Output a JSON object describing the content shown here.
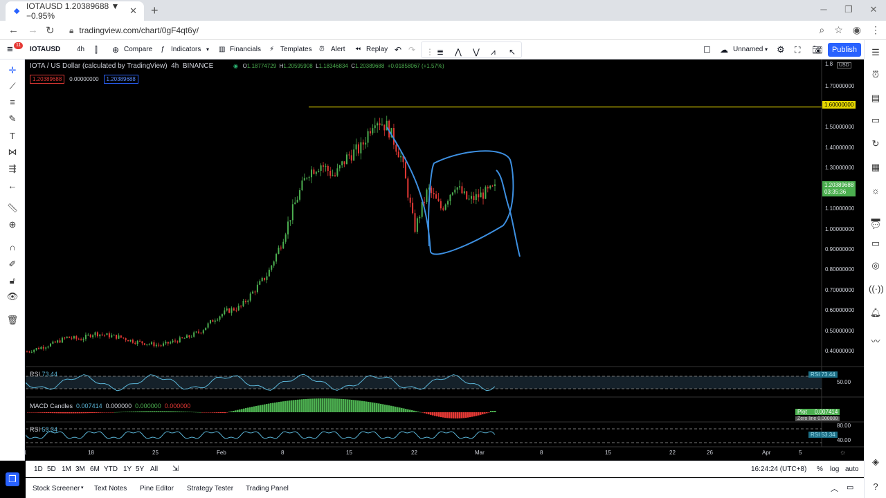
{
  "browser": {
    "tab_title": "IOTAUSD 1.20389688 ▼ −0.95%",
    "url": "tradingview.com/chart/0gF4qt6y/"
  },
  "toolbar": {
    "symbol": "IOTAUSD",
    "interval": "4h",
    "compare": "Compare",
    "indicators": "Indicators",
    "financials": "Financials",
    "templates": "Templates",
    "alert": "Alert",
    "replay": "Replay",
    "layout_name": "Unnamed",
    "publish": "Publish",
    "notification_count": "11"
  },
  "legend": {
    "title": "IOTA / US Dollar (calculated by TradingView)",
    "interval": "4h",
    "exchange": "BINANCE",
    "o_label": "O",
    "o": "1.18774729",
    "h_label": "H",
    "h": "1.20595908",
    "l_label": "L",
    "l": "1.18346834",
    "c_label": "C",
    "c": "1.20389688",
    "change": "+0.01858067 (+1.57%)",
    "bid": "1.20389688",
    "spread": "0.00000000",
    "ask": "1.20389688"
  },
  "price_axis": {
    "currency": "USD",
    "top_tick": "1.8",
    "ticks": [
      "1.70000000",
      "1.60000000",
      "1.50000000",
      "1.40000000",
      "1.30000000",
      "1.20000000",
      "1.10000000",
      "1.00000000",
      "0.90000000",
      "0.80000000",
      "0.70000000",
      "0.60000000",
      "0.50000000",
      "0.40000000"
    ],
    "hline_label": "1.60000000",
    "last_price": "1.20389688",
    "countdown": "03:35:36"
  },
  "rsi1": {
    "name": "RSI",
    "value": "73.44",
    "badge_name": "RSI",
    "badge_value": "73.44",
    "level": "50.00"
  },
  "macd": {
    "name": "MACD Candles",
    "v1": "0.007414",
    "v2": "0.000000",
    "v3": "0.000000",
    "v4": "0.000000",
    "plot_label": "Plot",
    "plot_value": "0.007414",
    "zero_label": "Zero line",
    "zero_value": "0.000000"
  },
  "rsi2": {
    "name": "RSI",
    "value": "53.34",
    "level_high": "80.00",
    "badge_name": "RSI",
    "badge_value": "53.34",
    "level_low": "40.00"
  },
  "time_axis": [
    "1",
    "18",
    "25",
    "Feb",
    "8",
    "15",
    "22",
    "Mar",
    "8",
    "15",
    "22",
    "26",
    "Apr",
    "5"
  ],
  "bottom_toolbar": {
    "ranges": [
      "1D",
      "5D",
      "1M",
      "3M",
      "6M",
      "YTD",
      "1Y",
      "5Y",
      "All"
    ],
    "time": "16:24:24 (UTC+8)",
    "percent": "%",
    "log": "log",
    "auto": "auto"
  },
  "bottom_panel": [
    "Stock Screener",
    "Text Notes",
    "Pine Editor",
    "Strategy Tester",
    "Trading Panel"
  ],
  "colors": {
    "accent": "#2962ff",
    "up": "#4caf50",
    "down": "#e53935",
    "rsi": "#5ab4d6",
    "hline": "#e6d800",
    "drawing": "#3d8fe0"
  },
  "chart_data": {
    "type": "candlestick",
    "symbol": "IOTAUSD",
    "ylim": [
      0.34,
      1.82
    ],
    "x_ticks": [
      "1",
      "18",
      "25",
      "Feb",
      "8",
      "15",
      "22",
      "Mar",
      "8",
      "15",
      "22",
      "26",
      "Apr",
      "5"
    ],
    "horizontal_line": 1.6,
    "close_path": [
      [
        0,
        0.4
      ],
      [
        1,
        0.42
      ],
      [
        2,
        0.44
      ],
      [
        3,
        0.47
      ],
      [
        4,
        0.46
      ],
      [
        5,
        0.49
      ],
      [
        6,
        0.48
      ],
      [
        7,
        0.47
      ],
      [
        8,
        0.45
      ],
      [
        9,
        0.44
      ],
      [
        10,
        0.43
      ],
      [
        11,
        0.45
      ],
      [
        12,
        0.47
      ],
      [
        13,
        0.5
      ],
      [
        14,
        0.56
      ],
      [
        15,
        0.6
      ],
      [
        16,
        0.62
      ],
      [
        17,
        0.7
      ],
      [
        18,
        0.78
      ],
      [
        19,
        0.93
      ],
      [
        20,
        1.12
      ],
      [
        21,
        1.28
      ],
      [
        22,
        1.32
      ],
      [
        23,
        1.26
      ],
      [
        24,
        1.36
      ],
      [
        25,
        1.4
      ],
      [
        26,
        1.55
      ],
      [
        27,
        1.5
      ],
      [
        28,
        1.35
      ],
      [
        29,
        1.0
      ],
      [
        30,
        1.2
      ],
      [
        31,
        1.1
      ],
      [
        32,
        1.22
      ],
      [
        33,
        1.14
      ],
      [
        34,
        1.17
      ],
      [
        35,
        1.2
      ]
    ],
    "rsi_last": 73.44,
    "rsi2_last": 53.34,
    "macd_last": 0.007414
  }
}
